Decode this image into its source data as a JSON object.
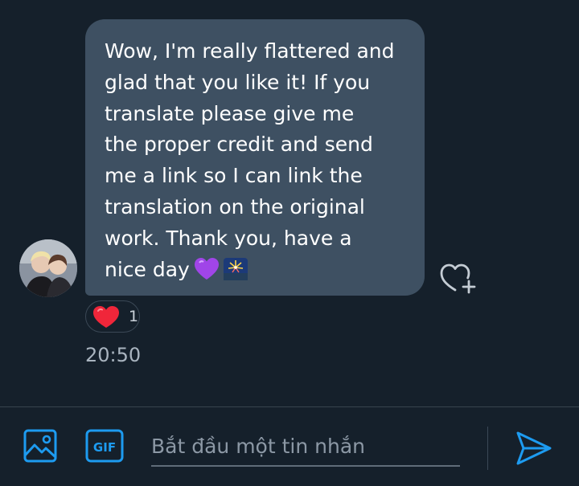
{
  "conversation": {
    "message": {
      "text": "Wow, I'm really flattered and\nglad that you like it! If you\ntranslate please give me\nthe proper credit and send\nme a link so I can link the\ntranslation on the original\nwork. Thank you, have a\nnice day",
      "emojis": [
        "💜",
        "🎆"
      ],
      "reaction": {
        "emoji": "❤",
        "count": "1"
      },
      "time": "20:50"
    }
  },
  "composer": {
    "placeholder": "Bắt đầu một tin nhắn",
    "gif_label": "GIF"
  },
  "colors": {
    "background": "#15202b",
    "bubble": "#3e5062",
    "accent": "#1d9bf0",
    "heart": "#f91880"
  },
  "icons": [
    "avatar-photo",
    "heart-add-icon",
    "image-icon",
    "gif-icon",
    "send-icon"
  ]
}
